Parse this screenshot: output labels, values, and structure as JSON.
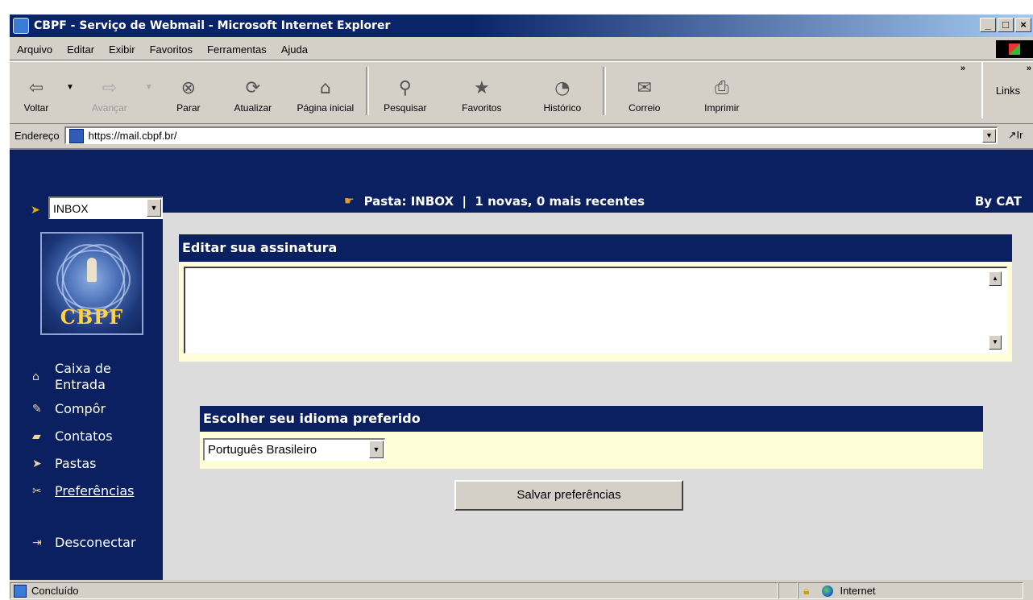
{
  "window": {
    "title": "CBPF - Serviço de Webmail - Microsoft Internet Explorer",
    "controls": {
      "minimize": "_",
      "maximize": "□",
      "close": "×"
    }
  },
  "menu": {
    "items": [
      "Arquivo",
      "Editar",
      "Exibir",
      "Favoritos",
      "Ferramentas",
      "Ajuda"
    ]
  },
  "toolbar": {
    "back": "Voltar",
    "forward": "Avançar",
    "stop": "Parar",
    "refresh": "Atualizar",
    "home": "Página inicial",
    "search": "Pesquisar",
    "favorites": "Favoritos",
    "history": "Histórico",
    "mail": "Correio",
    "print": "Imprimir",
    "links": "Links",
    "more": "»"
  },
  "address": {
    "label": "Endereço",
    "url": "https://mail.cbpf.br/",
    "go": "Ir"
  },
  "header": {
    "folder_select_value": "INBOX",
    "status": "Pasta: INBOX  |  1 novas, 0 mais recentes",
    "by": "By CAT"
  },
  "sidebar": {
    "logo_text": "CBPF",
    "items": [
      {
        "label_line1": "Caixa de",
        "label_line2": "Entrada"
      },
      {
        "label": "Compôr"
      },
      {
        "label": "Contatos"
      },
      {
        "label": "Pastas"
      },
      {
        "label": "Preferências"
      },
      {
        "label": "Desconectar"
      }
    ]
  },
  "signature": {
    "heading": "Editar sua assinatura",
    "value": ""
  },
  "language": {
    "heading": "Escolher seu idioma preferido",
    "selected": "Português Brasileiro"
  },
  "actions": {
    "save": "Salvar preferências"
  },
  "status": {
    "text": "Concluído",
    "zone": "Internet"
  }
}
